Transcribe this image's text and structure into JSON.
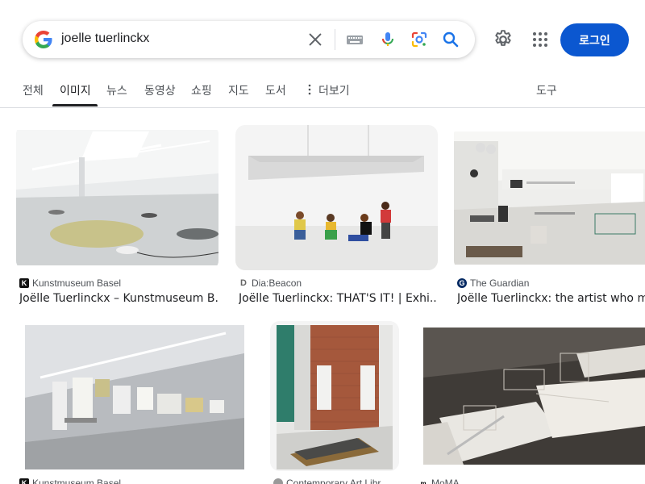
{
  "search": {
    "query": "joelle tuerlinckx"
  },
  "header": {
    "login_label": "로그인"
  },
  "tabs": [
    {
      "label": "전체"
    },
    {
      "label": "이미지"
    },
    {
      "label": "뉴스"
    },
    {
      "label": "동영상"
    },
    {
      "label": "쇼핑"
    },
    {
      "label": "지도"
    },
    {
      "label": "도서"
    },
    {
      "label": "더보기"
    }
  ],
  "tools_label": "도구",
  "results": [
    {
      "source": "Kunstmuseum Basel",
      "title": "Joëlle Tuerlinckx – Kunstmuseum B...",
      "favicon_icon": "kunstmuseum-favicon-icon"
    },
    {
      "source": "Dia:Beacon",
      "title": "Joëlle Tuerlinckx: THAT'S IT! | Exhi...",
      "favicon_icon": "dia-favicon-icon"
    },
    {
      "source": "The Guardian",
      "title": "Joëlle Tuerlinckx: the artist who mak",
      "favicon_icon": "guardian-favicon-icon"
    },
    {
      "source": "Kunstmuseum Basel",
      "title": "",
      "favicon_icon": "kunstmuseum-favicon-icon"
    },
    {
      "source": "Contemporary Art Libr",
      "title": "",
      "favicon_icon": "cal-favicon-icon"
    },
    {
      "source": "MoMA",
      "title": "",
      "favicon_icon": "moma-favicon-icon"
    }
  ],
  "colors": {
    "accent": "#0b57d0",
    "text": "#202124",
    "muted": "#4d5156"
  }
}
